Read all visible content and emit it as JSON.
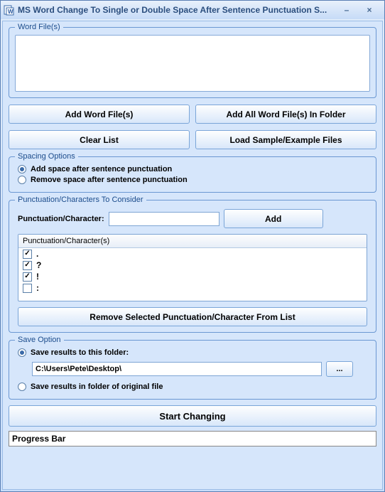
{
  "title": "MS Word Change To Single or Double Space After Sentence Punctuation S...",
  "word_files_group": "Word File(s)",
  "buttons": {
    "add_files": "Add Word File(s)",
    "add_folder": "Add All Word File(s) In Folder",
    "clear_list": "Clear List",
    "load_sample": "Load Sample/Example Files",
    "add_char": "Add",
    "remove_char": "Remove Selected Punctuation/Character From List",
    "browse": "...",
    "start": "Start Changing"
  },
  "spacing_group": "Spacing Options",
  "spacing_options": {
    "add": "Add space after sentence punctuation",
    "remove": "Remove space after sentence punctuation"
  },
  "punct_group": "Punctuation/Characters To Consider",
  "punct_label": "Punctuation/Character:",
  "punct_list_header": "Punctuation/Character(s)",
  "punct_items": [
    {
      "char": ".",
      "checked": true
    },
    {
      "char": "?",
      "checked": true
    },
    {
      "char": "!",
      "checked": true
    },
    {
      "char": ":",
      "checked": false
    }
  ],
  "save_group": "Save Option",
  "save_options": {
    "to_folder": "Save results to this folder:",
    "original": "Save results in folder of original file"
  },
  "save_path": "C:\\Users\\Pete\\Desktop\\",
  "progress_label": "Progress Bar"
}
